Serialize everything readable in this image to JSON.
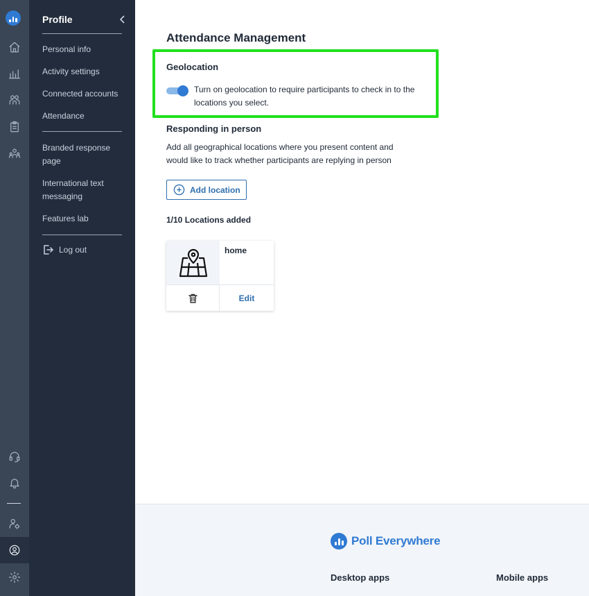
{
  "sidebar": {
    "title": "Profile",
    "items": [
      {
        "label": "Personal info"
      },
      {
        "label": "Activity settings"
      },
      {
        "label": "Connected accounts"
      },
      {
        "label": "Attendance"
      },
      {
        "label": "Branded response page"
      },
      {
        "label": "International text messaging"
      },
      {
        "label": "Features lab"
      }
    ],
    "logout_label": "Log out"
  },
  "main": {
    "title": "Attendance Management",
    "geolocation": {
      "title": "Geolocation",
      "enabled": true,
      "description": "Turn on geolocation to require participants to check in to the locations you select."
    },
    "responding": {
      "title": "Responding in person",
      "description": "Add all geographical locations where you present content and would like to track whether participants are replying in person",
      "add_label": "Add location"
    },
    "locations_count": "1/10 Locations added",
    "locations": [
      {
        "name": "home",
        "edit_label": "Edit"
      }
    ]
  },
  "footer": {
    "brand": "Poll Everywhere",
    "desktop": "Desktop apps",
    "mobile": "Mobile apps"
  },
  "colors": {
    "accent": "#2f7ad3",
    "sidebar_bg": "#222c3c",
    "rail_bg": "#3a4556",
    "highlight": "#22e01e"
  }
}
